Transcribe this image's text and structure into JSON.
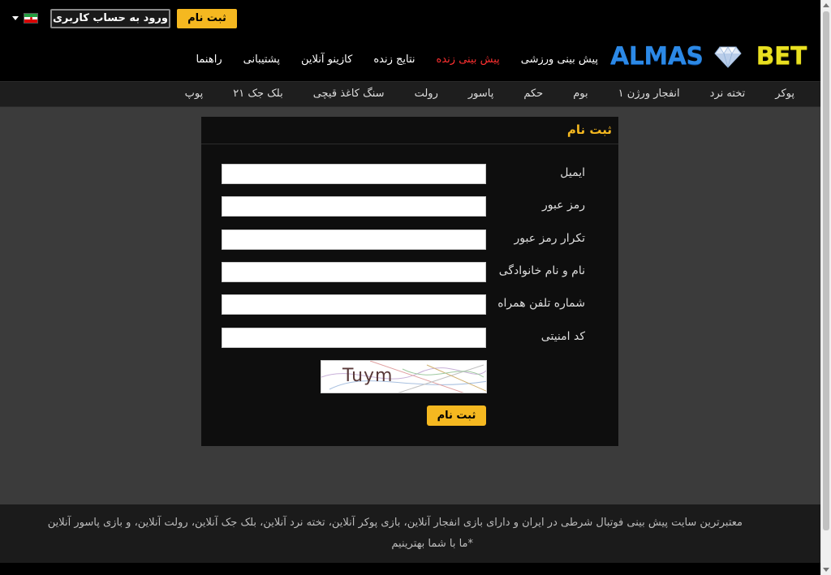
{
  "topbar": {
    "login_label": "ورود به حساب کاربری",
    "register_label": "ثبت نام",
    "language_flag": "iran-flag-icon"
  },
  "header": {
    "logo_left": "ALMAS",
    "logo_right": "BET",
    "nav": [
      {
        "label": "پیش بینی ورزشی",
        "active": false
      },
      {
        "label": "پیش بینی زنده",
        "active": true
      },
      {
        "label": "نتایج زنده",
        "active": false
      },
      {
        "label": "کازینو آنلاین",
        "active": false
      },
      {
        "label": "پشتیبانی",
        "active": false
      },
      {
        "label": "راهنما",
        "active": false
      }
    ]
  },
  "subnav": [
    "پوکر",
    "تخته نرد",
    "انفجار ورژن ۱",
    "بوم",
    "حکم",
    "پاسور",
    "رولت",
    "سنگ کاغذ قیچی",
    "بلک جک ۲۱",
    "پوپ"
  ],
  "form": {
    "title": "ثبت نام",
    "fields": [
      {
        "label": "ایمیل",
        "value": ""
      },
      {
        "label": "رمز عبور",
        "value": ""
      },
      {
        "label": "تکرار رمز عبور",
        "value": ""
      },
      {
        "label": "نام و نام خانوادگی",
        "value": ""
      },
      {
        "label": "شماره تلفن همراه",
        "value": ""
      },
      {
        "label": "کد امنیتی",
        "value": ""
      }
    ],
    "captcha_text": "Tuym",
    "submit_label": "ثبت نام"
  },
  "footer": {
    "line1": "معتبرترین سایت پیش بینی فوتبال شرطی در ایران و دارای بازی انفجار آنلاین، بازی پوکر آنلاین، تخته نرد آنلاین، بلک جک آنلاین، رولت آنلاین، و بازی پاسور آنلاین",
    "line2": "*ما با شما بهترینیم"
  },
  "colors": {
    "accent": "#f5b820",
    "active_nav": "#ff3030",
    "background": "#3b3b3b"
  }
}
